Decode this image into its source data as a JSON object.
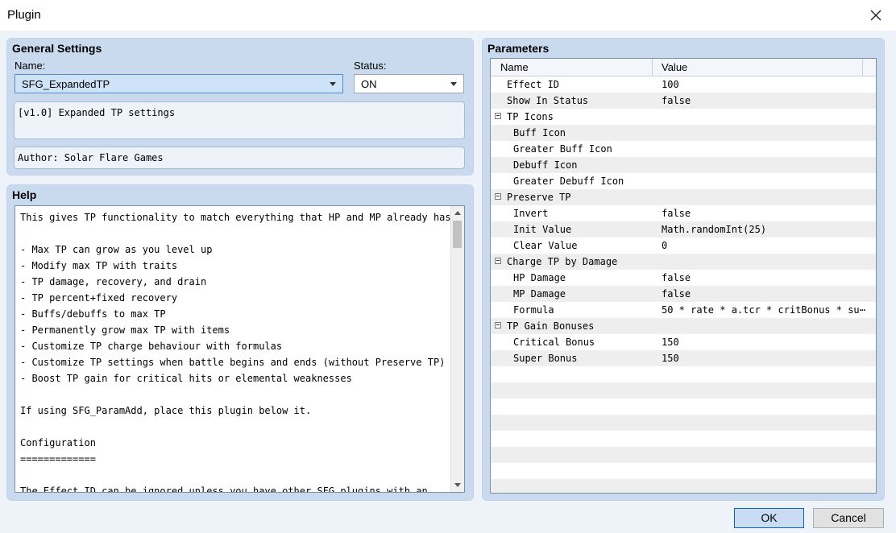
{
  "window": {
    "title": "Plugin"
  },
  "general": {
    "title": "General Settings",
    "name_label": "Name:",
    "name_value": "SFG_ExpandedTP",
    "status_label": "Status:",
    "status_value": "ON",
    "description": "[v1.0] Expanded TP settings",
    "author": "Author: Solar Flare Games"
  },
  "help": {
    "title": "Help",
    "lines": [
      "This gives TP functionality to match everything that HP and MP already has.",
      "",
      "- Max TP can grow as you level up",
      "- Modify max TP with traits",
      "- TP damage, recovery, and drain",
      "- TP percent+fixed recovery",
      "- Buffs/debuffs to max TP",
      "- Permanently grow max TP with items",
      "- Customize TP charge behaviour with formulas",
      "- Customize TP settings when battle begins and ends (without Preserve TP)",
      "- Boost TP gain for critical hits or elemental weaknesses",
      "",
      "If using SFG_ParamAdd, place this plugin below it.",
      "",
      "Configuration",
      "=============",
      "",
      "The Effect ID can be ignored unless you have other SFG plugins with an"
    ]
  },
  "parameters": {
    "title": "Parameters",
    "col_name": "Name",
    "col_value": "Value",
    "rows": [
      {
        "name": "Effect ID",
        "value": "100",
        "level": 0,
        "group": false
      },
      {
        "name": "Show In Status",
        "value": "false",
        "level": 0,
        "group": false
      },
      {
        "name": "TP Icons",
        "value": "",
        "level": 0,
        "group": true
      },
      {
        "name": "Buff Icon",
        "value": "",
        "level": 1,
        "group": false
      },
      {
        "name": "Greater Buff Icon",
        "value": "",
        "level": 1,
        "group": false
      },
      {
        "name": "Debuff Icon",
        "value": "",
        "level": 1,
        "group": false
      },
      {
        "name": "Greater Debuff Icon",
        "value": "",
        "level": 1,
        "group": false
      },
      {
        "name": "Preserve TP",
        "value": "",
        "level": 0,
        "group": true
      },
      {
        "name": "Invert",
        "value": "false",
        "level": 1,
        "group": false
      },
      {
        "name": "Init Value",
        "value": "Math.randomInt(25)",
        "level": 1,
        "group": false
      },
      {
        "name": "Clear Value",
        "value": "0",
        "level": 1,
        "group": false
      },
      {
        "name": "Charge TP by Damage",
        "value": "",
        "level": 0,
        "group": true
      },
      {
        "name": "HP Damage",
        "value": "false",
        "level": 1,
        "group": false
      },
      {
        "name": "MP Damage",
        "value": "false",
        "level": 1,
        "group": false
      },
      {
        "name": "Formula",
        "value": "50 * rate * a.tcr * critBonus * su⋯",
        "level": 1,
        "group": false
      },
      {
        "name": "TP Gain Bonuses",
        "value": "",
        "level": 0,
        "group": true
      },
      {
        "name": "Critical Bonus",
        "value": "150",
        "level": 1,
        "group": false
      },
      {
        "name": "Super Bonus",
        "value": "150",
        "level": 1,
        "group": false
      },
      {
        "name": "",
        "value": "",
        "level": 0,
        "group": false
      },
      {
        "name": "",
        "value": "",
        "level": 0,
        "group": false
      },
      {
        "name": "",
        "value": "",
        "level": 0,
        "group": false
      },
      {
        "name": "",
        "value": "",
        "level": 0,
        "group": false
      },
      {
        "name": "",
        "value": "",
        "level": 0,
        "group": false
      },
      {
        "name": "",
        "value": "",
        "level": 0,
        "group": false
      },
      {
        "name": "",
        "value": "",
        "level": 0,
        "group": false
      },
      {
        "name": "",
        "value": "",
        "level": 0,
        "group": false
      }
    ]
  },
  "buttons": {
    "ok": "OK",
    "cancel": "Cancel"
  },
  "icons": {
    "close": "close-icon",
    "dropdown": "chevron-down-icon",
    "collapse": "minus-box-icon"
  }
}
